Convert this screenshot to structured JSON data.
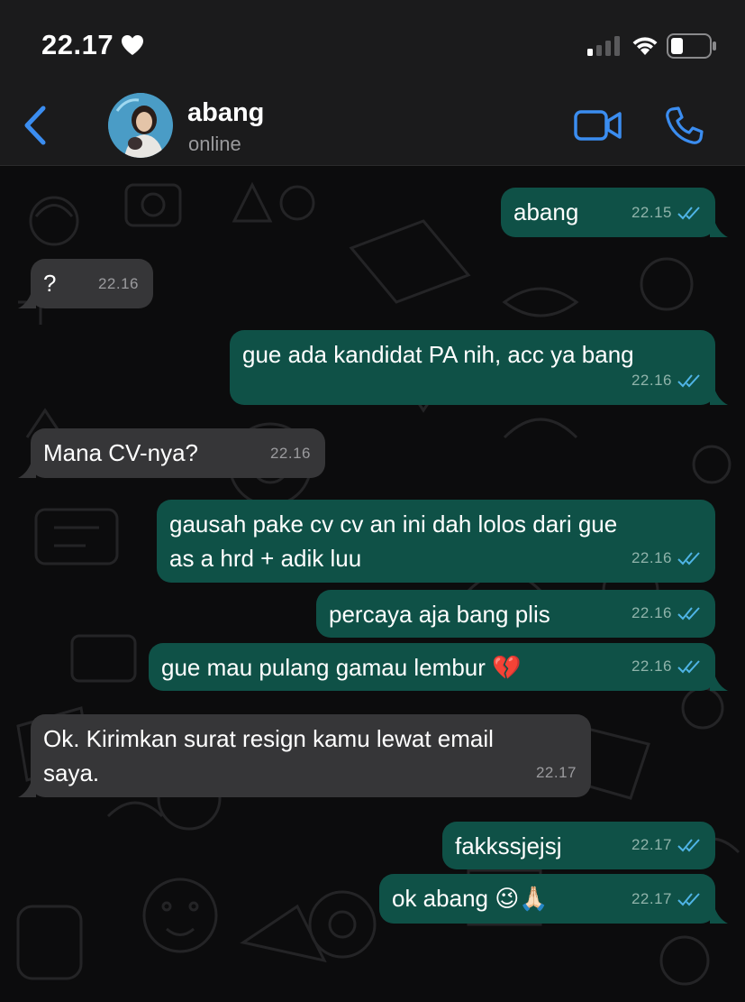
{
  "status_bar": {
    "time": "22.17"
  },
  "header": {
    "contact_name": "abang",
    "contact_status": "online"
  },
  "colors": {
    "accent": "#3b8df0",
    "outgoing_bubble": "#0f5147",
    "incoming_bubble": "#363638",
    "read_receipt": "#4fb4e6"
  },
  "messages": [
    {
      "direction": "out",
      "text": "abang",
      "time": "22.15",
      "read": true
    },
    {
      "direction": "in",
      "text": "?",
      "time": "22.16"
    },
    {
      "direction": "out",
      "text": "gue ada kandidat PA nih, acc ya bang",
      "time": "22.16",
      "read": true
    },
    {
      "direction": "in",
      "text": "Mana CV-nya?",
      "time": "22.16"
    },
    {
      "direction": "out",
      "text": "gausah pake cv cv an ini dah lolos dari gue\nas a hrd + adik luu",
      "time": "22.16",
      "read": true
    },
    {
      "direction": "out",
      "text": "percaya aja bang plis",
      "time": "22.16",
      "read": true
    },
    {
      "direction": "out",
      "text": "gue mau pulang gamau lembur 💔",
      "time": "22.16",
      "read": true
    },
    {
      "direction": "in",
      "text": "Ok. Kirimkan surat resign kamu lewat email\nsaya.",
      "time": "22.17"
    },
    {
      "direction": "out",
      "text": "fakkssjejsj",
      "time": "22.17",
      "read": true
    },
    {
      "direction": "out",
      "text": "ok abang 😉🙏🏻",
      "time": "22.17",
      "read": true
    }
  ]
}
